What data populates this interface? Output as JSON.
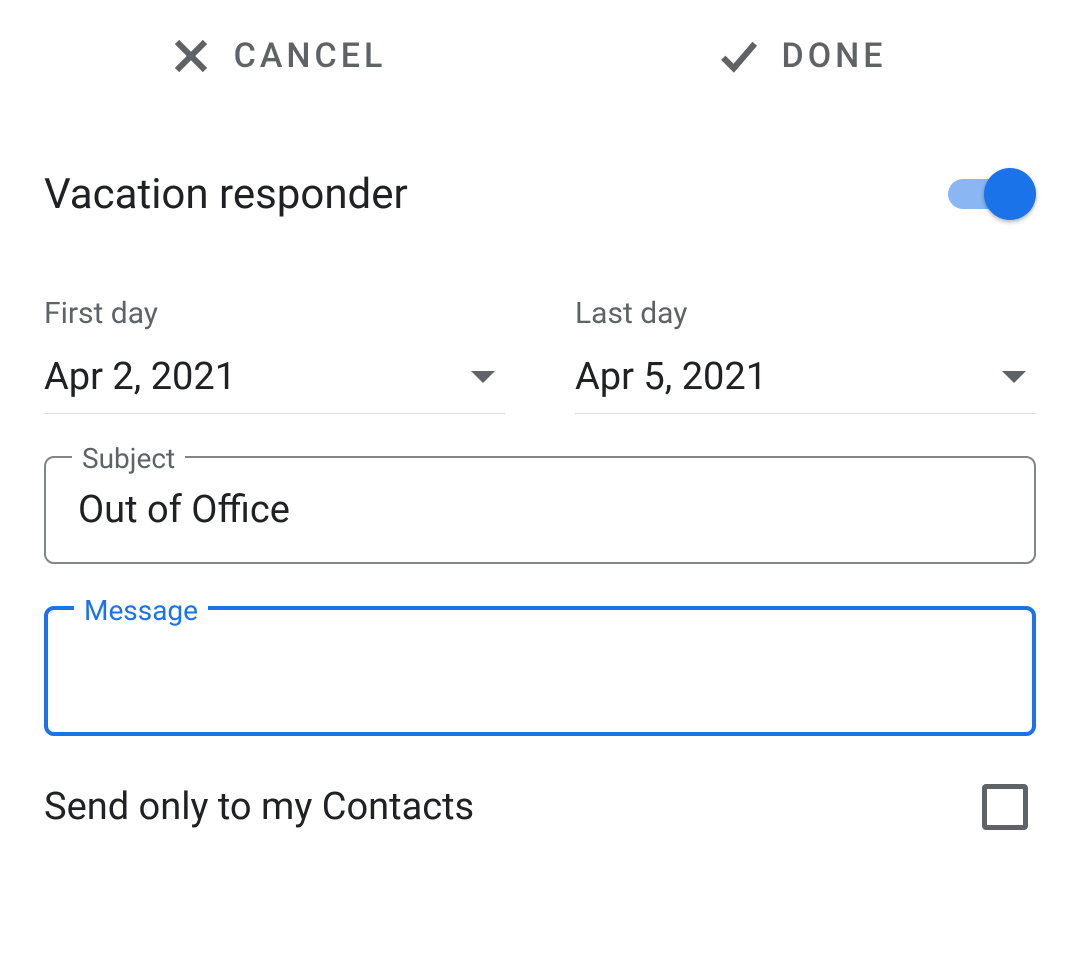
{
  "header": {
    "cancel_label": "CANCEL",
    "done_label": "DONE"
  },
  "section": {
    "title": "Vacation responder",
    "toggle_on": true
  },
  "dates": {
    "first_day_label": "First day",
    "first_day_value": "Apr 2, 2021",
    "last_day_label": "Last day",
    "last_day_value": "Apr 5, 2021"
  },
  "subject": {
    "label": "Subject",
    "value": "Out of Office"
  },
  "message": {
    "label": "Message",
    "value": ""
  },
  "contacts_only": {
    "label": "Send only to my Contacts",
    "checked": false
  }
}
